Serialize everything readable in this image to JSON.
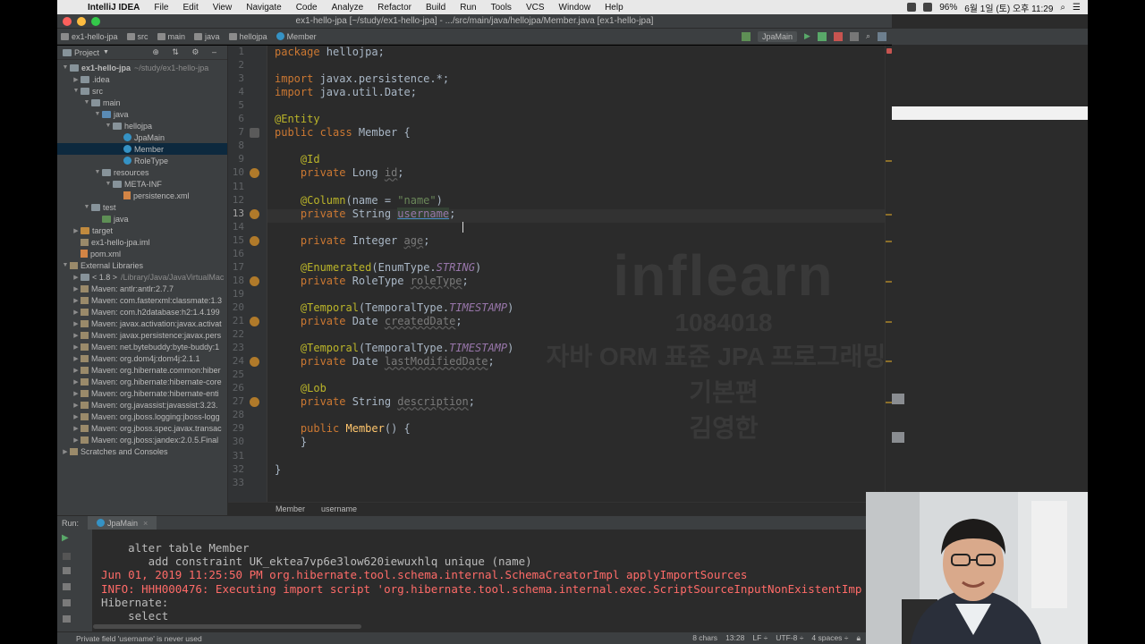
{
  "menubar": {
    "items": [
      "IntelliJ IDEA",
      "File",
      "Edit",
      "View",
      "Navigate",
      "Code",
      "Analyze",
      "Refactor",
      "Build",
      "Run",
      "Tools",
      "VCS",
      "Window",
      "Help"
    ],
    "battery": "96%",
    "clock": "6월 1일 (토) 오후 11:29"
  },
  "window": {
    "title": "ex1-hello-jpa [~/study/ex1-hello-jpa] - .../src/main/java/hellojpa/Member.java [ex1-hello-jpa]"
  },
  "navbar": {
    "crumbs": [
      "ex1-hello-jpa",
      "src",
      "main",
      "java",
      "hellojpa",
      "Member"
    ],
    "run_config": "JpaMain"
  },
  "project": {
    "header": "Project",
    "tree": [
      {
        "label": "ex1-hello-jpa",
        "extra": "~/study/ex1-hello-jpa",
        "depth": 0,
        "arrow": "▼",
        "icon": "folder",
        "bold": true
      },
      {
        "label": ".idea",
        "depth": 1,
        "arrow": "▶",
        "icon": "folder"
      },
      {
        "label": "src",
        "depth": 1,
        "arrow": "▼",
        "icon": "folder"
      },
      {
        "label": "main",
        "depth": 2,
        "arrow": "▼",
        "icon": "folder"
      },
      {
        "label": "java",
        "depth": 3,
        "arrow": "▼",
        "icon": "folder blue"
      },
      {
        "label": "hellojpa",
        "depth": 4,
        "arrow": "▼",
        "icon": "folder"
      },
      {
        "label": "JpaMain",
        "depth": 5,
        "arrow": "",
        "icon": "class"
      },
      {
        "label": "Member",
        "depth": 5,
        "arrow": "",
        "icon": "class",
        "selected": true
      },
      {
        "label": "RoleType",
        "depth": 5,
        "arrow": "",
        "icon": "class"
      },
      {
        "label": "resources",
        "depth": 3,
        "arrow": "▼",
        "icon": "folder"
      },
      {
        "label": "META-INF",
        "depth": 4,
        "arrow": "▼",
        "icon": "folder"
      },
      {
        "label": "persistence.xml",
        "depth": 5,
        "arrow": "",
        "icon": "xml"
      },
      {
        "label": "test",
        "depth": 2,
        "arrow": "▼",
        "icon": "folder"
      },
      {
        "label": "java",
        "depth": 3,
        "arrow": "",
        "icon": "folder green"
      },
      {
        "label": "target",
        "depth": 1,
        "arrow": "▶",
        "icon": "folder orange"
      },
      {
        "label": "ex1-hello-jpa.iml",
        "depth": 1,
        "arrow": "",
        "icon": "jar"
      },
      {
        "label": "pom.xml",
        "depth": 1,
        "arrow": "",
        "icon": "xml"
      },
      {
        "label": "External Libraries",
        "depth": 0,
        "arrow": "▼",
        "icon": "jar"
      },
      {
        "label": "< 1.8 >",
        "extra": "/Library/Java/JavaVirtualMac",
        "depth": 1,
        "arrow": "▶",
        "icon": "folder"
      },
      {
        "label": "Maven: antlr:antlr:2.7.7",
        "depth": 1,
        "arrow": "▶",
        "icon": "jar"
      },
      {
        "label": "Maven: com.fasterxml:classmate:1.3",
        "depth": 1,
        "arrow": "▶",
        "icon": "jar"
      },
      {
        "label": "Maven: com.h2database:h2:1.4.199",
        "depth": 1,
        "arrow": "▶",
        "icon": "jar"
      },
      {
        "label": "Maven: javax.activation:javax.activat",
        "depth": 1,
        "arrow": "▶",
        "icon": "jar"
      },
      {
        "label": "Maven: javax.persistence:javax.pers",
        "depth": 1,
        "arrow": "▶",
        "icon": "jar"
      },
      {
        "label": "Maven: net.bytebuddy:byte-buddy:1",
        "depth": 1,
        "arrow": "▶",
        "icon": "jar"
      },
      {
        "label": "Maven: org.dom4j:dom4j:2.1.1",
        "depth": 1,
        "arrow": "▶",
        "icon": "jar"
      },
      {
        "label": "Maven: org.hibernate.common:hiber",
        "depth": 1,
        "arrow": "▶",
        "icon": "jar"
      },
      {
        "label": "Maven: org.hibernate:hibernate-core",
        "depth": 1,
        "arrow": "▶",
        "icon": "jar"
      },
      {
        "label": "Maven: org.hibernate:hibernate-enti",
        "depth": 1,
        "arrow": "▶",
        "icon": "jar"
      },
      {
        "label": "Maven: org.javassist:javassist:3.23.",
        "depth": 1,
        "arrow": "▶",
        "icon": "jar"
      },
      {
        "label": "Maven: org.jboss.logging:jboss-logg",
        "depth": 1,
        "arrow": "▶",
        "icon": "jar"
      },
      {
        "label": "Maven: org.jboss.spec.javax.transac",
        "depth": 1,
        "arrow": "▶",
        "icon": "jar"
      },
      {
        "label": "Maven: org.jboss:jandex:2.0.5.Final",
        "depth": 1,
        "arrow": "▶",
        "icon": "jar"
      },
      {
        "label": "Scratches and Consoles",
        "depth": 0,
        "arrow": "▶",
        "icon": "jar"
      }
    ]
  },
  "editor": {
    "lines": [
      "<span class=\"kw\">package</span> hellojpa;",
      "",
      "<span class=\"kw\">import</span> javax.persistence.*;",
      "<span class=\"kw\">import</span> java.util.Date;",
      "",
      "<span class=\"ann\">@Entity</span>",
      "<span class=\"kw\">public class</span> Member {",
      "",
      "    <span class=\"ann\">@Id</span>",
      "    <span class=\"kw\">private</span> Long <span class=\"unused\">id</span>;",
      "",
      "    <span class=\"ann\">@Column</span>(name = <span class=\"str\">\"name\"</span>)",
      "    <span class=\"kw\">private</span> String <span class=\"sel-field\">username</span>;",
      "",
      "    <span class=\"kw\">private</span> Integer <span class=\"unused\">age</span>;",
      "",
      "    <span class=\"ann\">@Enumerated</span>(EnumType.<span class=\"ital\">STRING</span>)",
      "    <span class=\"kw\">private</span> RoleType <span class=\"unused\">roleType</span>;",
      "",
      "    <span class=\"ann\">@Temporal</span>(TemporalType.<span class=\"ital\">TIMESTAMP</span>)",
      "    <span class=\"kw\">private</span> Date <span class=\"unused\">createdDate</span>;",
      "",
      "    <span class=\"ann\">@Temporal</span>(TemporalType.<span class=\"ital\">TIMESTAMP</span>)",
      "    <span class=\"kw\">private</span> Date <span class=\"unused\">lastModifiedDate</span>;",
      "",
      "    <span class=\"ann\">@Lob</span>",
      "    <span class=\"kw\">private</span> String <span class=\"unused\">description</span>;",
      "",
      "    <span class=\"kw\">public</span> <span style=\"color:#ffc66d\">Member</span>() {",
      "    }",
      "",
      "}",
      ""
    ],
    "current_line": 13,
    "gutter_marks": [
      10,
      13,
      15,
      18,
      21,
      24,
      27
    ],
    "bottom_crumbs": [
      "Member",
      "username"
    ],
    "watermark": {
      "logo": "inflearn",
      "id": "1084018",
      "course": "자바 ORM 표준 JPA 프로그래밍 - 기본편",
      "author": "김영한"
    }
  },
  "run": {
    "label": "Run:",
    "tab": "JpaMain",
    "console": [
      {
        "text": "    alter table Member",
        "kind": "norm"
      },
      {
        "text": "       add constraint UK_ektea7vp6e3low620iewuxhlq unique (name)",
        "kind": "norm"
      },
      {
        "text": "Jun 01, 2019 11:25:50 PM org.hibernate.tool.schema.internal.SchemaCreatorImpl applyImportSources",
        "kind": "err"
      },
      {
        "text": "INFO: HHH000476: Executing import script 'org.hibernate.tool.schema.internal.exec.ScriptSourceInputNonExistentImp",
        "kind": "err"
      },
      {
        "text": "Hibernate:",
        "kind": "norm"
      },
      {
        "text": "    select",
        "kind": "norm"
      }
    ]
  },
  "status": {
    "message": "Private field 'username' is never used",
    "chars": "8 chars",
    "position": "13:28",
    "line_sep": "LF ÷",
    "encoding": "UTF-8 ÷",
    "indent": "4 spaces ÷"
  },
  "colors": {
    "accent": "#3592c4",
    "error": "#ff6b68",
    "keyword": "#cc7832",
    "annotation": "#bbb529"
  }
}
